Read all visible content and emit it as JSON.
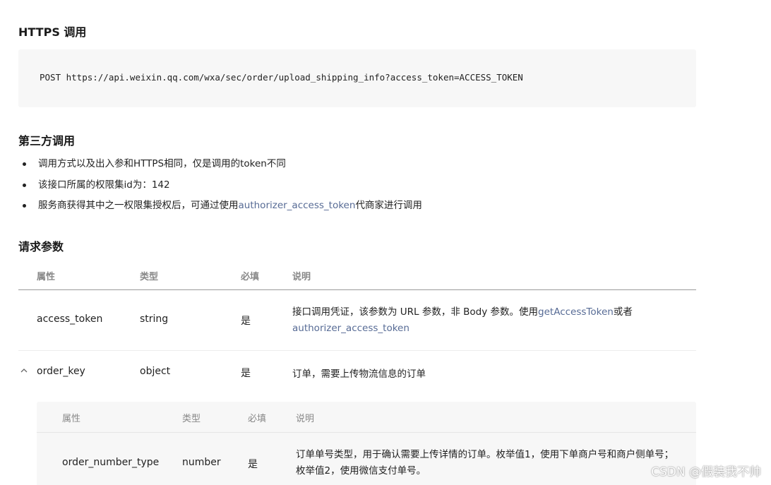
{
  "sections": {
    "https_title": "HTTPS 调用",
    "third_party_title": "第三方调用",
    "params_title": "请求参数"
  },
  "code": {
    "line": "POST https://api.weixin.qq.com/wxa/sec/order/upload_shipping_info?access_token=ACCESS_TOKEN"
  },
  "bullets": {
    "b1": "调用方式以及出入参和HTTPS相同，仅是调用的token不同",
    "b2": "该接口所属的权限集id为：142",
    "b3_prefix": "服务商获得其中之一权限集授权后，可通过使用",
    "b3_link": "authorizer_access_token",
    "b3_suffix": "代商家进行调用"
  },
  "table": {
    "headers": [
      "属性",
      "类型",
      "必填",
      "说明"
    ],
    "rows": [
      {
        "name": "access_token",
        "type": "string",
        "required": "是",
        "desc_prefix": "接口调用凭证，该参数为 URL 参数，非 Body 参数。使用",
        "desc_link1": "getAccessToken",
        "desc_mid": "或者",
        "desc_link2": "authorizer_access_token"
      },
      {
        "name": "order_key",
        "type": "object",
        "required": "是",
        "desc": "订单，需要上传物流信息的订单"
      }
    ]
  },
  "subtable": {
    "headers": [
      "属性",
      "类型",
      "必填",
      "说明"
    ],
    "rows": [
      {
        "name": "order_number_type",
        "type": "number",
        "required": "是",
        "desc_line1": "订单单号类型，用于确认需要上传详情的订单。枚举值1，使用下单商户号和商户侧单号；",
        "desc_line2": "枚举值2，使用微信支付单号。"
      }
    ]
  },
  "watermark": "CSDN @假装我不帅",
  "colors": {
    "link": "#576b95",
    "code_bg": "#f7f7f7",
    "header_text": "#888888"
  },
  "icons": {
    "expand": "chevron-up-icon"
  }
}
